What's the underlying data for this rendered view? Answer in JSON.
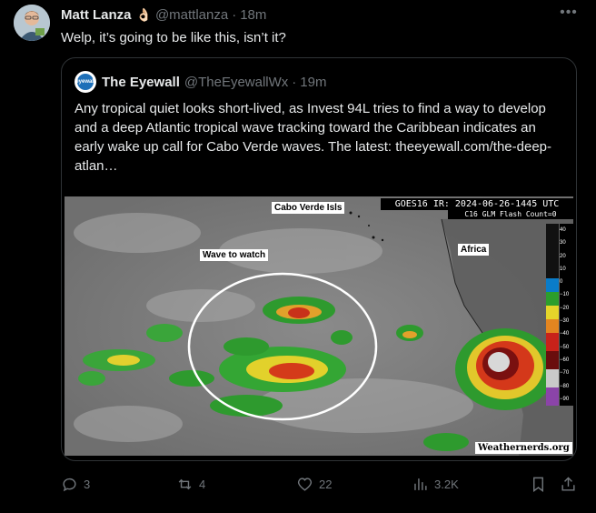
{
  "post": {
    "author_name": "Matt Lanza",
    "author_emoji": "👌🏻",
    "handle": "@mattlanza",
    "separator": "·",
    "time": "18m",
    "more_label": "•••",
    "text": "Welp, it’s going to be like this, isn’t it?"
  },
  "quote": {
    "author_name": "The Eyewall",
    "handle": "@TheEyewallWx",
    "separator": "·",
    "time": "19m",
    "avatar_text": "eyewall",
    "text": "Any tropical quiet looks short-lived, as Invest 94L tries to find a way to develop and a deep Atlantic tropical wave tracking toward the Caribbean indicates an early wake up call for Cabo Verde waves. The latest: ",
    "link_text": "theeyewall.com/the-deep-atlan…",
    "image": {
      "header": "GOES16 IR: 2024-06-26-1445 UTC",
      "subheader": "C16 GLM Flash Count=0",
      "label_cabo_verde": "Cabo Verde Isls",
      "label_wave": "Wave to watch",
      "label_africa": "Africa",
      "credit": "Weathernerds.org",
      "scale_ticks": [
        "40",
        "30",
        "20",
        "10",
        "0",
        "−10",
        "−20",
        "−30",
        "−40",
        "−50",
        "−60",
        "−70",
        "−80",
        "−90"
      ]
    }
  },
  "actions": {
    "replies": "3",
    "reposts": "4",
    "likes": "22",
    "views": "3.2K"
  },
  "colors": {
    "background": "#000000",
    "text": "#e7e9ea",
    "muted": "#71767b",
    "border": "#2f3336"
  }
}
